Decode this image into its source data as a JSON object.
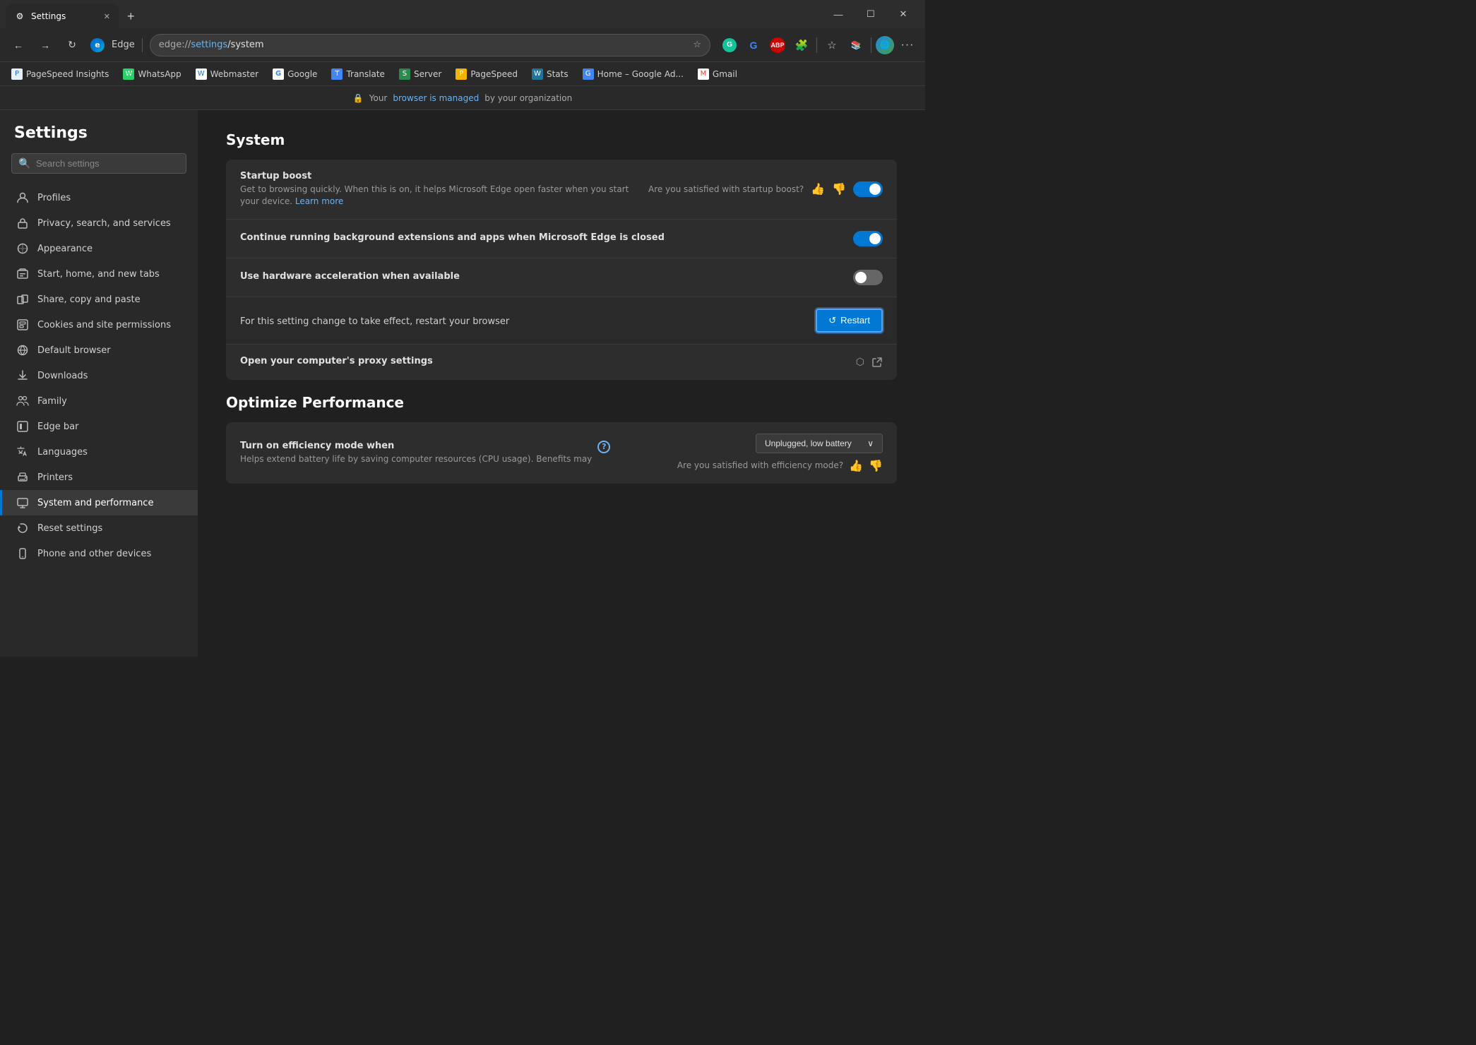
{
  "browser": {
    "title": "Settings",
    "tab_favicon": "⚙",
    "tab_label": "Settings",
    "url_scheme": "edge://",
    "url_path": "settings",
    "url_sub": "/system",
    "new_tab_tooltip": "New tab"
  },
  "titlebar_controls": {
    "minimize": "—",
    "maximize": "☐",
    "close": "✕"
  },
  "navbar": {
    "back": "←",
    "forward": "→",
    "refresh": "↻",
    "edge_label": "Edge",
    "address": "edge://settings/system",
    "favorites_icon": "☆",
    "extensions_icon": "🧩",
    "collections_icon": "📚",
    "profile_icon": "🌐",
    "menu_icon": "···"
  },
  "bookmarks": [
    {
      "id": "pagespeed1",
      "label": "PageSpeed Insights",
      "color": "#e8f0fe",
      "text_color": "#1a73e8",
      "char": "P"
    },
    {
      "id": "whatsapp",
      "label": "WhatsApp",
      "color": "#25d366",
      "text_color": "white",
      "char": "W"
    },
    {
      "id": "webmaster",
      "label": "Webmaster",
      "color": "#fff",
      "text_color": "#1a73e8",
      "char": "W"
    },
    {
      "id": "google",
      "label": "Google",
      "color": "white",
      "text_color": "#4285f4",
      "char": "G"
    },
    {
      "id": "translate",
      "label": "Translate",
      "color": "#4285f4",
      "text_color": "white",
      "char": "T"
    },
    {
      "id": "server",
      "label": "Server",
      "color": "#2d8a4e",
      "text_color": "white",
      "char": "S"
    },
    {
      "id": "pagespeed2",
      "label": "PageSpeed",
      "color": "#f4b400",
      "text_color": "white",
      "char": "P"
    },
    {
      "id": "stats",
      "label": "Stats",
      "color": "#21759b",
      "text_color": "white",
      "char": "W"
    },
    {
      "id": "homeads",
      "label": "Home – Google Ad...",
      "color": "#4285f4",
      "text_color": "white",
      "char": "G"
    },
    {
      "id": "gmail",
      "label": "Gmail",
      "color": "white",
      "text_color": "#ea4335",
      "char": "M"
    }
  ],
  "managed_notice": {
    "text_before": "Your ",
    "link_text": "browser is managed",
    "text_after": " by your organization"
  },
  "sidebar": {
    "title": "Settings",
    "search_placeholder": "Search settings",
    "nav_items": [
      {
        "id": "profiles",
        "icon": "👤",
        "label": "Profiles",
        "active": false
      },
      {
        "id": "privacy",
        "icon": "🔒",
        "label": "Privacy, search, and services",
        "active": false
      },
      {
        "id": "appearance",
        "icon": "🎨",
        "label": "Appearance",
        "active": false
      },
      {
        "id": "start-home",
        "icon": "🖥",
        "label": "Start, home, and new tabs",
        "active": false
      },
      {
        "id": "share-copy",
        "icon": "📋",
        "label": "Share, copy and paste",
        "active": false
      },
      {
        "id": "cookies",
        "icon": "🗂",
        "label": "Cookies and site permissions",
        "active": false
      },
      {
        "id": "default-browser",
        "icon": "🌐",
        "label": "Default browser",
        "active": false
      },
      {
        "id": "downloads",
        "icon": "⬇",
        "label": "Downloads",
        "active": false
      },
      {
        "id": "family",
        "icon": "👨‍👩‍👧",
        "label": "Family",
        "active": false
      },
      {
        "id": "edge-bar",
        "icon": "📊",
        "label": "Edge bar",
        "active": false
      },
      {
        "id": "languages",
        "icon": "🔤",
        "label": "Languages",
        "active": false
      },
      {
        "id": "printers",
        "icon": "🖨",
        "label": "Printers",
        "active": false
      },
      {
        "id": "system",
        "icon": "💻",
        "label": "System and performance",
        "active": true
      },
      {
        "id": "reset",
        "icon": "↺",
        "label": "Reset settings",
        "active": false
      },
      {
        "id": "phone",
        "icon": "📱",
        "label": "Phone and other devices",
        "active": false
      }
    ]
  },
  "content": {
    "section_system": {
      "title": "System",
      "rows": [
        {
          "id": "startup-boost",
          "title": "Startup boost",
          "description": "Get to browsing quickly. When this is on, it helps Microsoft Edge open faster when you start your device.",
          "link_text": "Learn more",
          "right_label": "Are you satisfied with startup boost?",
          "toggle": "on",
          "show_thumbs": true
        },
        {
          "id": "background-running",
          "title": "Continue running background extensions and apps when Microsoft Edge is closed",
          "description": "",
          "toggle": "on",
          "show_thumbs": false
        },
        {
          "id": "hardware-acceleration",
          "title": "Use hardware acceleration when available",
          "description": "",
          "toggle": "off",
          "show_thumbs": false,
          "sub_row": true
        },
        {
          "id": "restart-notice",
          "text": "For this setting change to take effect, restart your browser",
          "is_restart_row": true
        },
        {
          "id": "proxy-settings",
          "title": "Open your computer's proxy settings",
          "description": "",
          "external": true,
          "show_thumbs": false,
          "toggle": null
        }
      ]
    },
    "section_performance": {
      "title": "Optimize Performance",
      "rows": [
        {
          "id": "efficiency-mode",
          "title": "Turn on efficiency mode when",
          "description": "Helps extend battery life by saving computer resources (CPU usage). Benefits may",
          "show_info": true,
          "dropdown_value": "Unplugged, low battery",
          "right_label": "Are you satisfied with efficiency mode?",
          "show_thumbs": true
        }
      ]
    },
    "restart_button_label": "Restart",
    "restart_icon": "↺"
  }
}
